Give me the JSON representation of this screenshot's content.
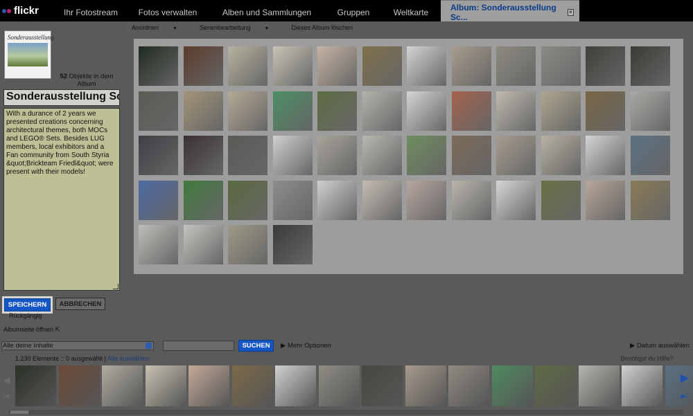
{
  "header": {
    "logo": "flickr",
    "tabs": [
      {
        "label": "Ihr Fotostream"
      },
      {
        "label": "Fotos verwalten"
      },
      {
        "label": "Alben und Sammlungen"
      },
      {
        "label": "Gruppen"
      },
      {
        "label": "Weltkarte"
      },
      {
        "label": "Album: Sonderausstellung Sc..."
      }
    ],
    "close_glyph": "×"
  },
  "album": {
    "cover_title": "Sonderausstellung",
    "count": "52",
    "count_label": "Objekte in dem Album",
    "title_value": "Sonderausstellung Sc",
    "description": "With a durance of 2 years we presented creations concerning architectural themes, both MOCs and LEGO® Sets. Besides LUG members, local exhibitors and a Fan community from South Styria &quot;Brickteam Friedl&quot; were present with their models!",
    "save_label": "SPEICHERN",
    "cancel_label": "ABBRECHEN",
    "undo_label": "Rückgängig",
    "album_page_label": "Albumseite öffnen"
  },
  "toolbar": {
    "arrange": "Anordnen",
    "batch": "Serienbearbeitung",
    "delete": "Dieses Album löschen"
  },
  "grid": {
    "thumbs": [
      "#1f2a20",
      "#5b3b2c",
      "#b7b39f",
      "#c9c4b6",
      "#c6b3a4",
      "#80704a",
      "#d3d3d3",
      "#a89c8e",
      "#8d8a80",
      "#8c8a85",
      "#403f3a",
      "#3a3c35",
      "#5b5c55",
      "#a29478",
      "#b5a996",
      "#4a8f64",
      "#5e6d44",
      "#b4b2ac",
      "#d5d5d5",
      "#a5624c",
      "#c0bbb1",
      "#aea68f",
      "#796645",
      "#a8a8a4",
      "#3e3f44",
      "#3b3232",
      "#5a5b57",
      "#d0d0d0",
      "#a8a49c",
      "#b7b8b0",
      "#6f8e5e",
      "#7b6a58",
      "#a69d90",
      "#b8b1a3",
      "#d4d4d4",
      "#5b7182",
      "#4c6aa4",
      "#3f7a3c",
      "#5a6a3f",
      "#8d8d8b",
      "#cfcfcf",
      "#c5bdb4",
      "#b7a6a0",
      "#b9b5ad",
      "#d6d6d6",
      "#6b7045",
      "#b9a79a",
      "#8a7b56",
      "#bfbdb8",
      "#c6c4bf",
      "#9e9a86",
      "#3b3c3a"
    ]
  },
  "bottom": {
    "filter_value": "Alle deine Inhalte",
    "search_placeholder": "",
    "search_label": "SUCHEN",
    "more_label": "Mehr Optionen",
    "date_label": "Datum auswählen",
    "stats_text": "1.230 Elemente :: 0 ausgewählt |",
    "select_all": "Alle auswählen",
    "help": "Benötigst du Hilfe?",
    "strip": [
      "#2b3126",
      "#6c4a36",
      "#b0aca0",
      "#c8c1b1",
      "#c3aa98",
      "#7d6a48",
      "#d1d1d1",
      "#8f8c84",
      "#47483f",
      "#a79a8c",
      "#8f8a82",
      "#4f8c60",
      "#5f6b44",
      "#b6b4ad",
      "#d2d2d2",
      "#5b7182"
    ],
    "nav_left": "◀",
    "nav_right": "▶",
    "nav_left_end": "|◀",
    "nav_right_end": "▶|"
  },
  "colors": {
    "accent": "#1556c6",
    "title_tab": "#0c3a8a",
    "overlay": "#5a5a5a"
  }
}
